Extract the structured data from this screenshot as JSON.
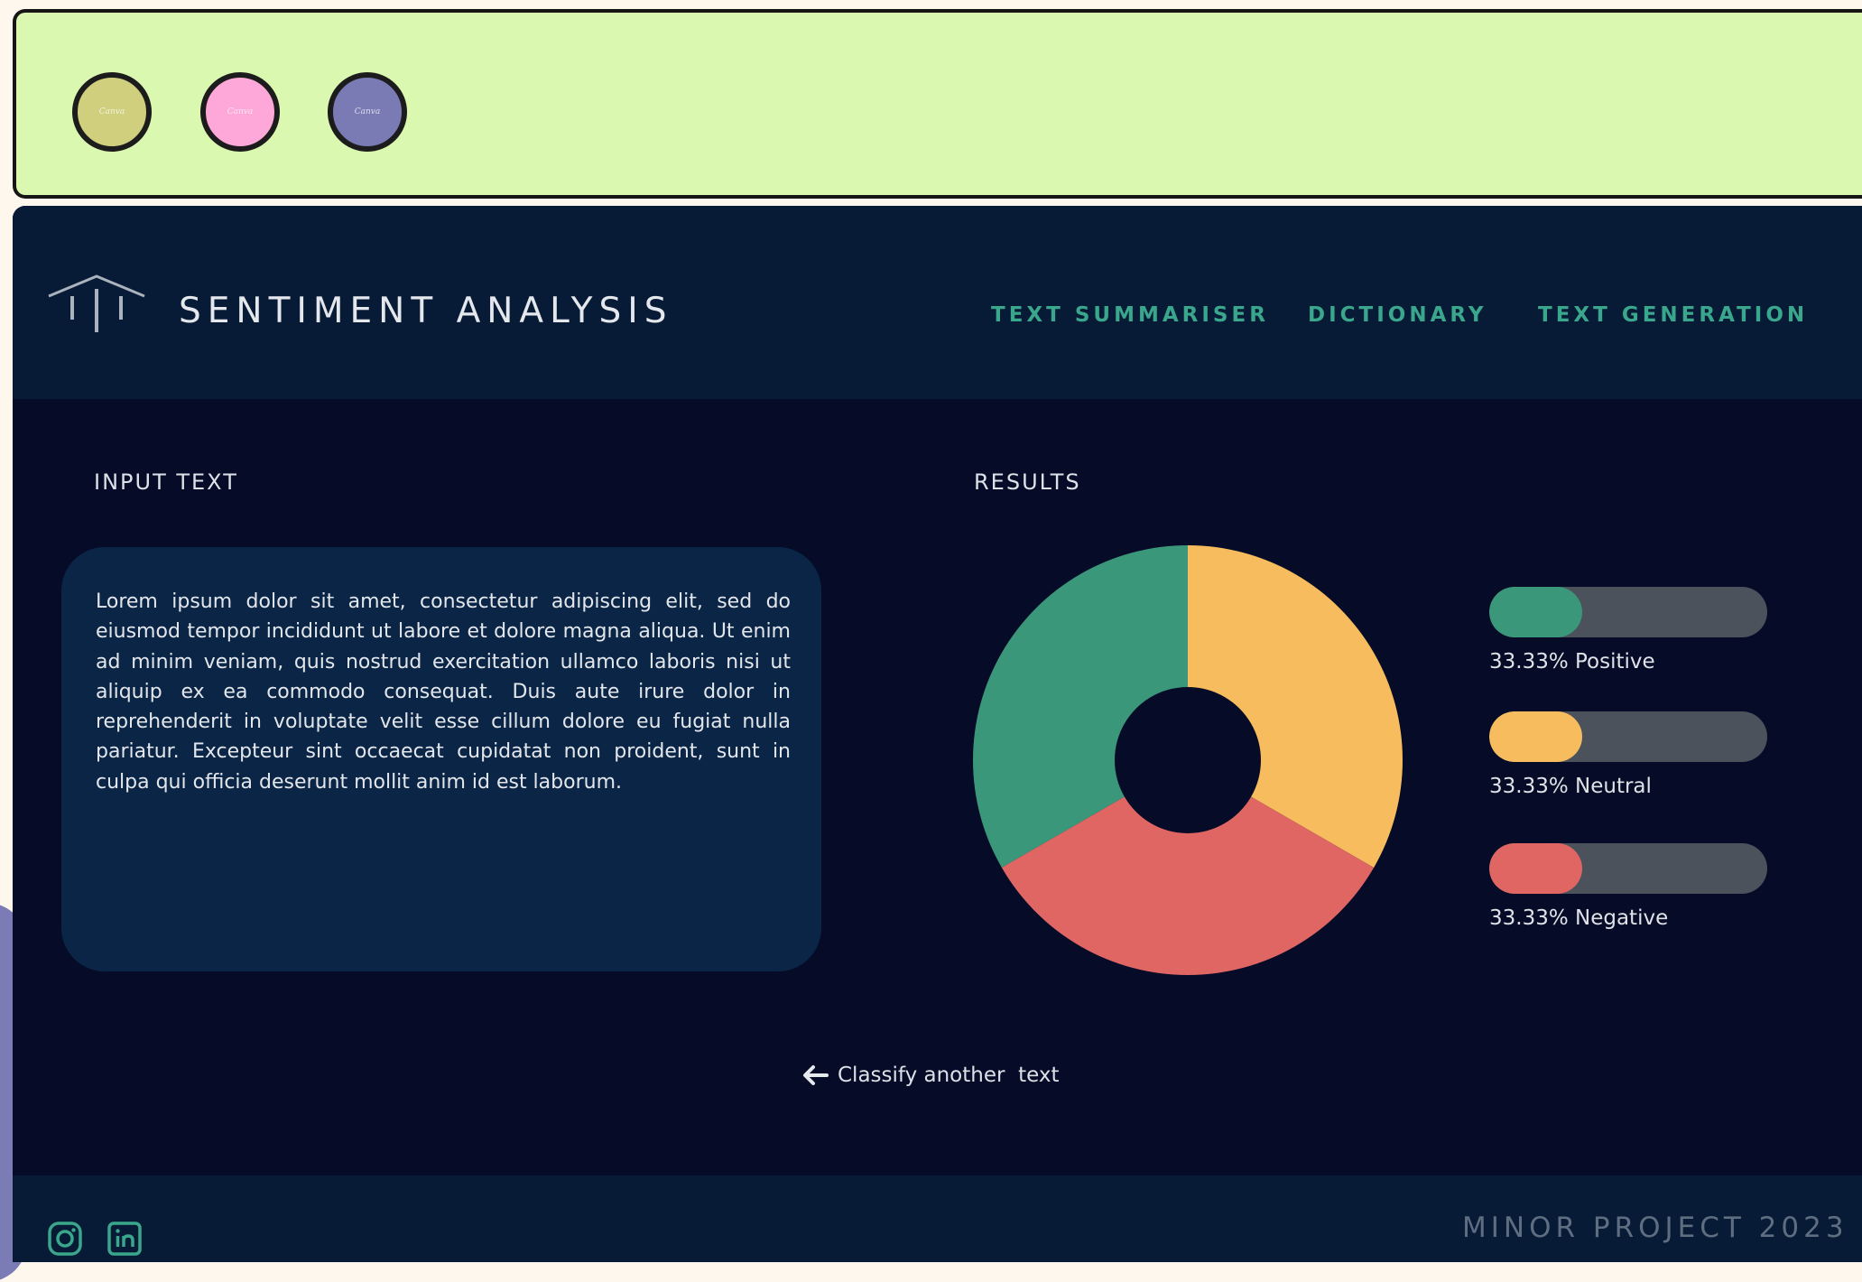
{
  "window": {
    "controls": [
      {
        "name": "window-control-1",
        "color": "#cfcf7d",
        "label": "Canva"
      },
      {
        "name": "window-control-2",
        "color": "#fda8d8",
        "label": "Canva"
      },
      {
        "name": "window-control-3",
        "color": "#7a7ab5",
        "label": "Canva"
      }
    ]
  },
  "header": {
    "title": "SENTIMENT ANALYSIS",
    "logo_icon": "pillars-icon",
    "nav": [
      "TEXT SUMMARISER",
      "DICTIONARY",
      "TEXT GENERATION"
    ]
  },
  "input": {
    "label": "INPUT TEXT",
    "text": "Lorem ipsum dolor sit amet, consectetur adipiscing elit, sed do eiusmod tempor incididunt ut labore et dolore magna aliqua. Ut enim ad minim veniam, quis nostrud exercitation ullamco laboris nisi ut aliquip ex ea commodo consequat. Duis aute irure dolor in reprehenderit in voluptate velit esse cillum dolore eu fugiat nulla pariatur. Excepteur sint occaecat cupidatat non proident, sunt in culpa qui officia deserunt mollit anim id est laborum."
  },
  "results": {
    "label": "RESULTS",
    "items": [
      {
        "label": "33.33% Positive",
        "value": 33.33,
        "color": "#3a977a"
      },
      {
        "label": "33.33% Neutral",
        "value": 33.33,
        "color": "#f7bc5d"
      },
      {
        "label": "33.33% Negative",
        "value": 33.33,
        "color": "#e06664"
      }
    ],
    "bar_track_color": "#4b525b"
  },
  "actions": {
    "classify_label": "Classify another  text",
    "classify_icon": "arrow-left-icon"
  },
  "footer": {
    "text": "MINOR PROJECT 2023",
    "social_icons": [
      "instagram-icon",
      "linkedin-icon"
    ]
  }
}
